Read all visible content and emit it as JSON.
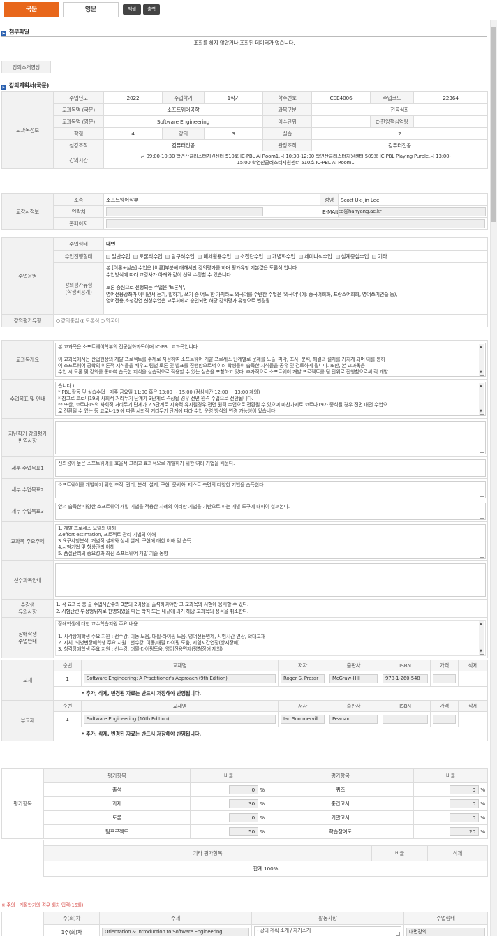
{
  "tabs": {
    "korean": "국문",
    "english": "영문"
  },
  "toolbar": {
    "excel": "엑셀",
    "print": "출력"
  },
  "attach": {
    "title": "첨부파일",
    "empty": "조회를 하지 않았거나 조회된 데이터가 없습니다."
  },
  "video": {
    "label": "강의소개영상"
  },
  "plan": {
    "title": "강의계획서(국문)"
  },
  "course": {
    "group": "교과목정보",
    "year_l": "수업년도",
    "year": "2022",
    "term_l": "수업학기",
    "term": "1학기",
    "num_l": "학수번호",
    "num": "CSE4006",
    "code_l": "수업코드",
    "code": "22364",
    "name_ko_l": "교과목명 (국문)",
    "name_ko": "소프트웨어공학",
    "cat_l": "과목구분",
    "cat": "전공심화",
    "name_en_l": "교과목명 (영문)",
    "name_en": "Software Engineering",
    "unit_l": "이수단위",
    "unit": "",
    "core_l": "C-한양핵심역량",
    "core": "",
    "credit_l": "학점",
    "credit": "4",
    "lecture_l": "강의",
    "lecture": "3",
    "lab_l": "실습",
    "lab": "2",
    "org_l": "설강조직",
    "org": "컴퓨터전공",
    "mgr_l": "관장조직",
    "mgr": "컴퓨터전공",
    "time_l": "강의시간",
    "time1": "금 09:00-10:30 학연산클러스터지원센터 510호 IC-PBL AI Room1,금 10:30-12:00 학연산클러스터지원센터 509호 IC-PBL Playing Purple,금 13:00-",
    "time2": "15:00 학연산클러스터지원센터 510호 IC-PBL AI Room1"
  },
  "instructor": {
    "group": "교강사정보",
    "dept_l": "소속",
    "dept": "소프트웨어학부",
    "name_l": "성명",
    "name": "Scott Uk-Jin Lee",
    "contact_l": "연락처",
    "contact": "",
    "email_l": "E-MAIL",
    "email": "scottlee@hanyang.ac.kr",
    "home_l": "홈페이지",
    "home": ""
  },
  "operation": {
    "group": "수업운영",
    "form_l": "수업형태",
    "form": "대면",
    "type_l": "수업진행형태",
    "types": [
      "일반수업",
      "토론식수업",
      "탐구식수업",
      "매체활용수업",
      "소집단수업",
      "개별화수업",
      "세미나식수업",
      "설계중심수업",
      "기타"
    ],
    "eval_l": "강의평가유형\n(학생비공개)",
    "eval1": "본 [이론+실습] 수업은 [이론]부분에 대해서만 강의평가를 하며 평가유형 기본값은 토론식 입니다.",
    "eval2": "수업방식에 따라 교강사가 아래와 같이 선택 수정할 수 있습니다.",
    "eval3": "토론 중심으로 진행되는 수업은 '토론식',",
    "eval4": "영어전용강좌가 아니면서 듣기, 말하기, 쓰기 중 어느 한 가지라도 외국어를 수반한 수업은 '외국어' (예: 중국어회화, 프랑스어회화, 영어쓰기연습 등),",
    "eval5": "영어전용,초청강연 신청수업은 교무처에서 승인되면 해당 강의평가 유형으로 변경됨",
    "etype_l": "강의평가유형",
    "etypes": [
      "강의중심",
      "토론식",
      "외국어"
    ]
  },
  "desc": {
    "overview_l": "교과목개요",
    "overview": "본 교과목은 소프트웨어학부의 전공심화과목이며 IC-PBL 교과목입니다.\n\n이 교과목에서는 산업현장의 개발 프로젝트를 주제로 지정하여 소프트웨어 개발 프로세스 단계별로 문제를 도출, 파악, 조사, 분석, 해결의 절차를 거치게 되며 이를 통하\n여 소프트웨어 공학의 이론적 지식들을 배우고 팀별 토론 및 발표를 진행함으로써 여러 학생들이 습득한 지식들을 공유 및 검토하게 됩니다. 또한, 본 교과목은\n수업 시 토론 및 강의를 통하여 습득한 지식을 실습적으로 적용할 수 있는 실습을 포함하고 있다. 추가적으로 소프트웨어 개발 프로젝트를 팀 단위로 진행함으로써 각 개발",
    "goal_l": "수업목표 및 안내",
    "goal": "습니다.)\n* PBL 활동 및 실습수업 : 매주 금요일 11:00 혹은 13:00 ~ 15:00 (점심시간 12:00 ~ 13:00 제외)\n* 참고로 코로나19의 사회적 거리두기 단계가 3단계로 격상될 경우 전면 원격 수업으로 전환됩니다.\n** 또한, 코로나19의 사회적 거리두기 단계가 2.5단계로 지속적 유지될경우 전면 원격 수업으로 전환될 수 있으며 마찬가지로 코로나19가 종식될 경우 전면 대면 수업으\n로 전환될 수 있는 등 코로나19 에 따른 사회적 거리두기 단계에 따라 수업 운영 방식의 변경 가능성이 있습니다.",
    "prev_l": "지난학기 강의평가\n반영사항",
    "prev": "",
    "g1_l": "세부 수업목표1",
    "g1": "신뢰성이 높은 소프트웨어를 효율적 그리고 효과적으로 개발하기 위한 여러 기법을 배운다.",
    "g2_l": "세부 수업목표2",
    "g2": "소프트웨어를 개발하기 위한 조직, 관리, 분석, 설계, 구현, 문서화, 테스트 측면의 다양한 기법을 습득한다.",
    "g3_l": "세부 수업목표3",
    "g3": "앞서 습득한 다양한 소프트웨어 개발 기법을 적용한 사례와 이러한 기법을 기반으로 하는 개발 도구에 대하여 살펴본다.",
    "topics_l": "교과목 주요주제",
    "topics": "1. 개발 프로세스 모델의 이해\n2.effort estimation, 프로젝트 관리 기법의 이해\n3.요구사항분석, 개념적 설계와 상세 설계, 구현에 대한 이해 및 습득\n4.시험기법 및 형상관리 이해\n5. 품질관리의 중요성과 최신 소프트웨어 개발 기술 동향",
    "pre_l": "선수과목안내",
    "pre": "",
    "notice_l": "수강생\n유의사항",
    "notice1": "1. 각 교과목 총 출 수업시간수의 3분의 2이상을 출석하여야만 그 교과목의 시험에 응시할 수 있다.",
    "notice2": "2. 시험관련 부정행위자로 판명되었을 때는 학칙 또는 내규에 의거 해당 교과목의 성적을 취소한다.",
    "dis_l": "장애학생\n수업안내",
    "dis": "장애학생에 대한 교수학습지원 주요 내용\n\n1. 시각장애학생 주요 지원 : 선수강, 이동 도움, 대필-타이핑 도움, 영어전용면제, 시험시간 연장, 확대교재\n2. 지체, 뇌병변장애학생 주요 지원 : 선수강, 이동/대필 타이핑 도움, 시험시간연장(상지장애)\n3. 청각장애학생 주요 지원 : 선수강, 대필-타이핑도움, 영어전용면제(평형장애 제외)"
  },
  "books": {
    "group": "교재",
    "sub_group": "부교재",
    "headers": [
      "순번",
      "교재명",
      "저자",
      "출판사",
      "ISBN",
      "가격",
      "삭제"
    ],
    "main": [
      {
        "no": "1",
        "title": "Software Engineering: A Practitioner's Approach (9th Edition)",
        "author": "Roger S. Pressr",
        "pub": "McGraw-Hill",
        "isbn": "978-1-260-548",
        "price": ""
      }
    ],
    "sub": [
      {
        "no": "1",
        "title": "Software Engineering (10th Edition)",
        "author": "Ian Sommervill",
        "pub": "Pearson",
        "isbn": "",
        "price": ""
      }
    ],
    "note": "* 추가, 삭제, 변경된 자료는 반드시 저장해야 반영됩니다."
  },
  "grading": {
    "group": "평가항목",
    "h_item": "평가항목",
    "h_ratio": "비율",
    "pct": "%",
    "left": [
      {
        "item": "출석",
        "v": "0"
      },
      {
        "item": "과제",
        "v": "30"
      },
      {
        "item": "토론",
        "v": "0"
      },
      {
        "item": "팀프로젝트",
        "v": "50"
      }
    ],
    "right": [
      {
        "item": "퀴즈",
        "v": "0"
      },
      {
        "item": "중간고사",
        "v": "0"
      },
      {
        "item": "기말고사",
        "v": "0"
      },
      {
        "item": "학습참여도",
        "v": "20"
      }
    ],
    "other_h": "기타 평가항목",
    "other_ratio": "비율",
    "other_del": "삭제",
    "total": "합계 100%"
  },
  "weekly": {
    "warn": "※ 주의 : 계절학기의 경우 회차 입력(15회)",
    "h_week": "주(회)차",
    "h_topic": "주제",
    "h_act": "활동사항",
    "h_form": "수업형태",
    "r1_week": "1주(회)차",
    "r1_topic": "Orientation & Introduction to Software Engineering",
    "r1_act": "- 강의 계획 소개 / 자기소개",
    "r1_form": "대면강의"
  }
}
